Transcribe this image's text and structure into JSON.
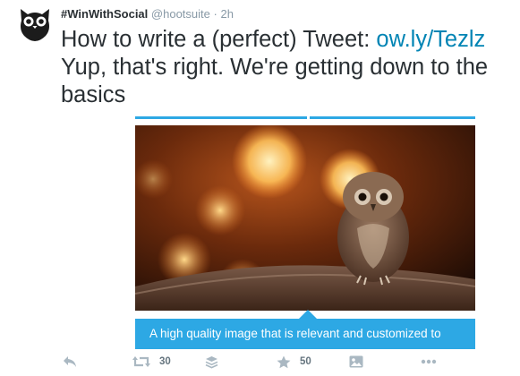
{
  "tweet": {
    "display_name": "#WinWithSocial",
    "handle": "@hootsuite",
    "separator": "·",
    "time": "2h",
    "text_line1_prefix": "How to write a (perfect) Tweet: ",
    "link": "ow.ly/Tezlz",
    "text_rest": "Yup, that's right. We're getting down to the basics"
  },
  "card": {
    "caption": "A high quality image that is relevant and customized to",
    "accent_color": "#2da8e4"
  },
  "actions": {
    "reply_icon": "reply-icon",
    "retweet_icon": "retweet-icon",
    "retweet_count": "30",
    "buffer_icon": "buffer-icon",
    "favorite_icon": "star-icon",
    "favorite_count": "50",
    "image_icon": "image-icon",
    "more_icon": "more-dots-icon"
  },
  "colors": {
    "text": "#292f33",
    "muted": "#8899a6",
    "link": "#0084b4",
    "accent": "#2da8e4"
  }
}
